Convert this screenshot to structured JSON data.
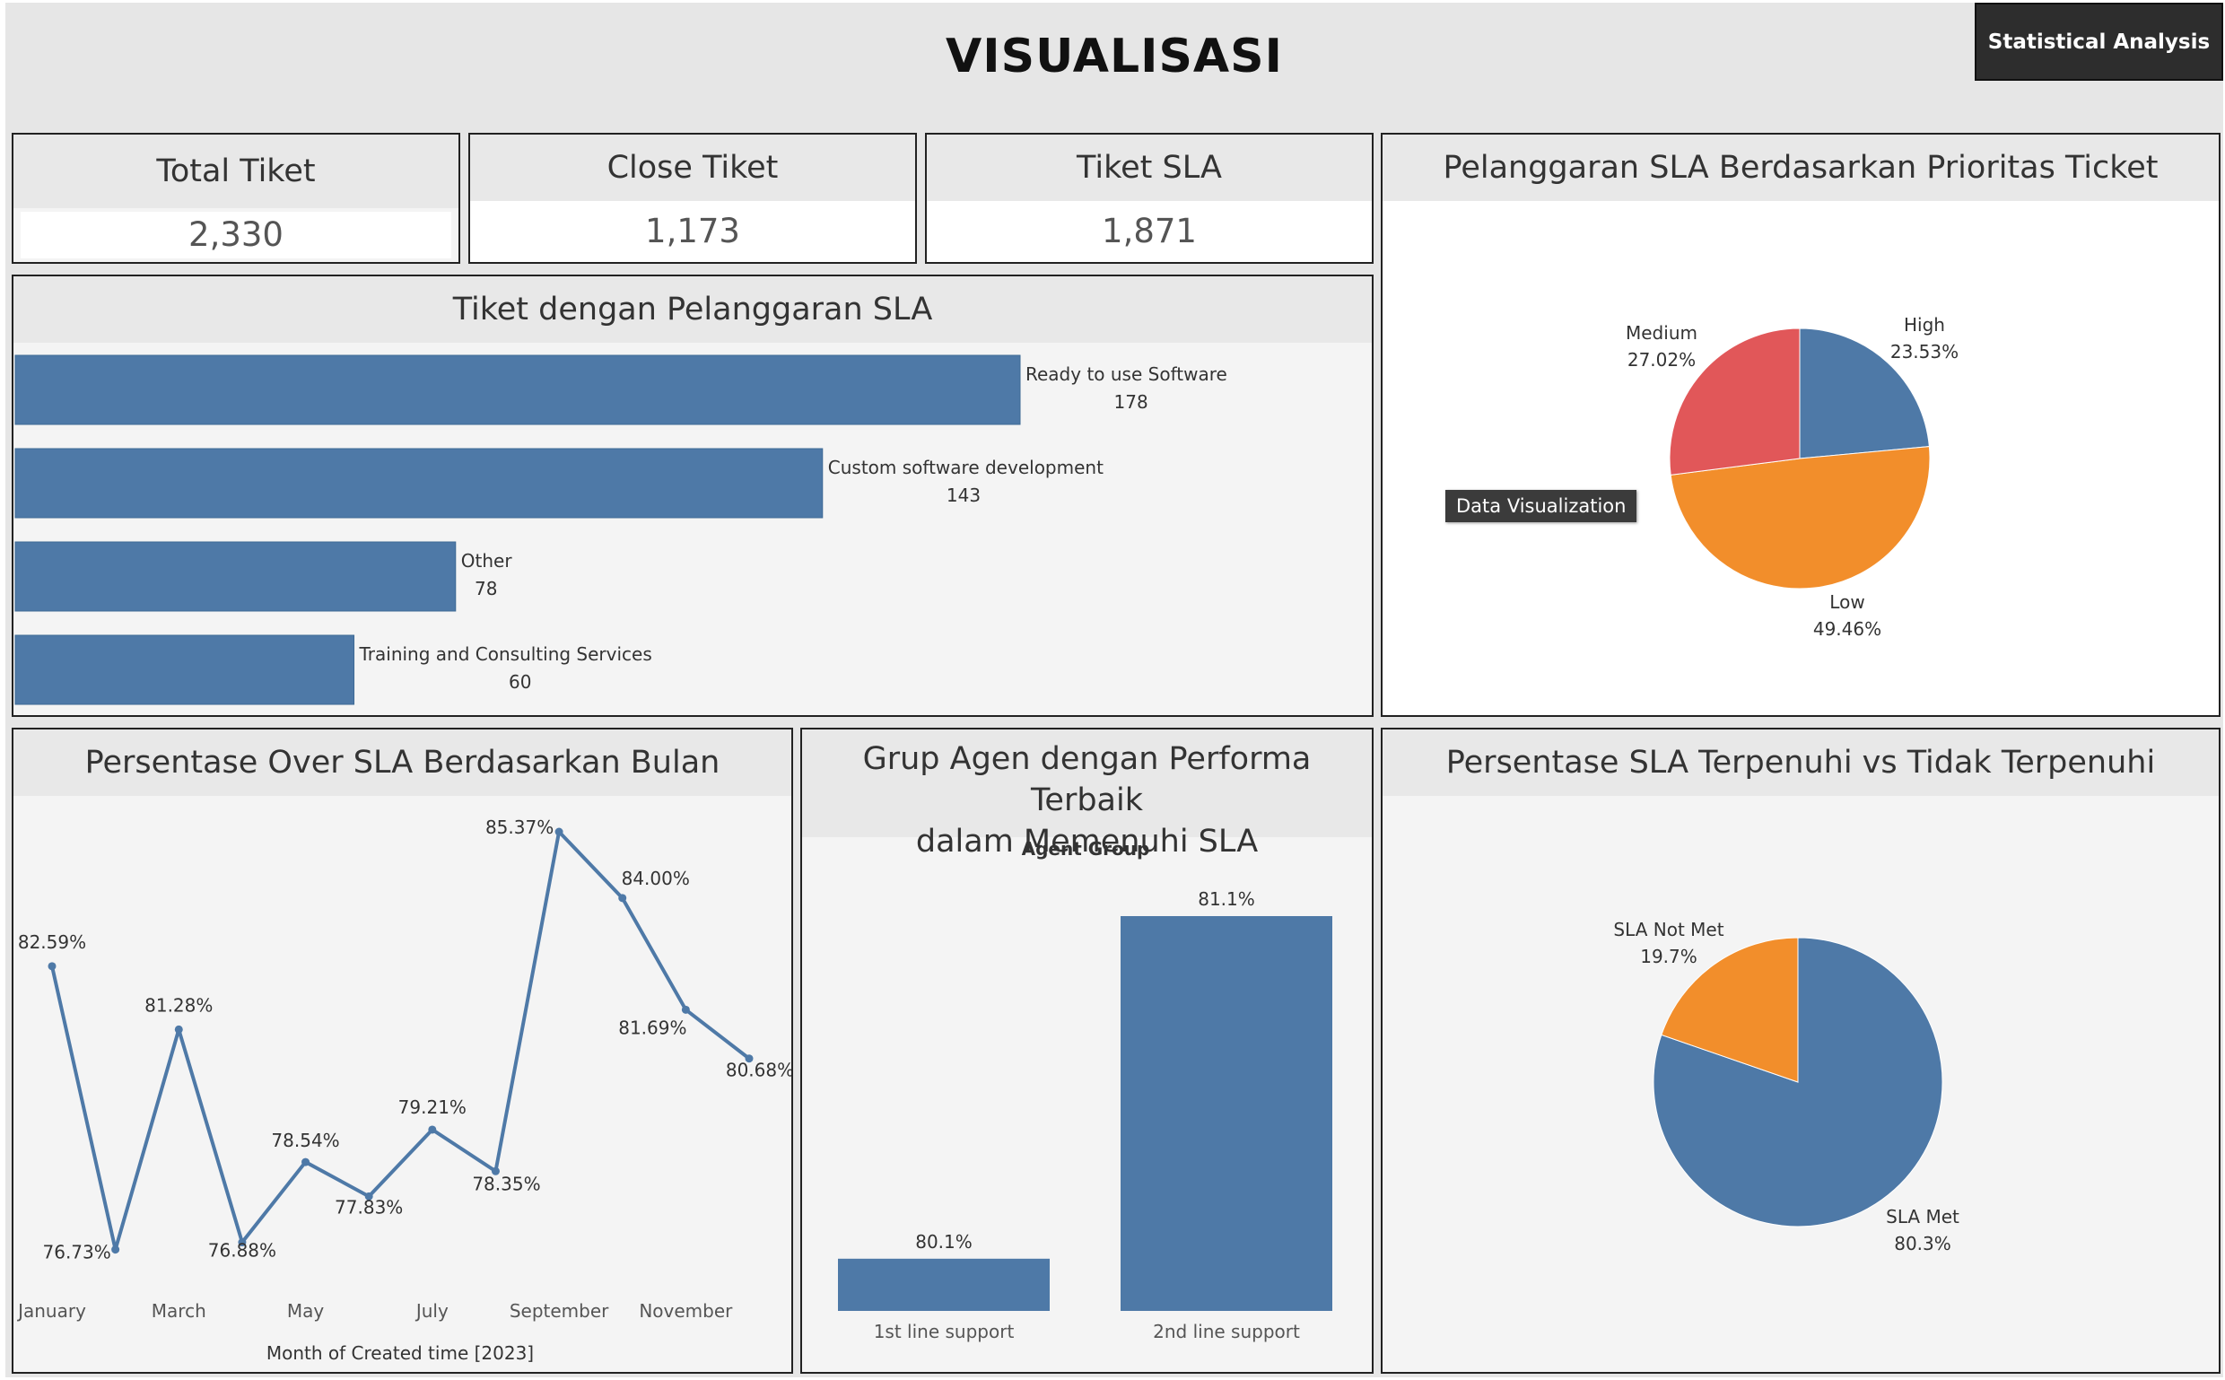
{
  "page": {
    "title": "VISUALISASI"
  },
  "toolbar": {
    "statistical_analysis_label": "Statistical Analysis"
  },
  "kpis": [
    {
      "label": "Total Tiket",
      "value": "2,330"
    },
    {
      "label": "Close Tiket",
      "value": "1,173"
    },
    {
      "label": "Tiket SLA",
      "value": "1,871"
    }
  ],
  "colors": {
    "blue": "#4e79a7",
    "orange": "#f28e2b",
    "red": "#e15759"
  },
  "panels": {
    "bar_violations": {
      "title": "Tiket dengan Pelanggaran SLA"
    },
    "priority_pie": {
      "title": "Pelanggaran SLA Berdasarkan Prioritas Ticket",
      "tooltip": "Data Visualization"
    },
    "monthly_line": {
      "title": "Persentase Over SLA Berdasarkan Bulan"
    },
    "agent_group": {
      "title_line1": "Grup Agen dengan Performa Terbaik",
      "title_line2": "dalam Memenuhi SLA"
    },
    "sla_pie": {
      "title": "Persentase SLA Terpenuhi vs Tidak Terpenuhi"
    }
  },
  "chart_data": [
    {
      "type": "bar",
      "orientation": "horizontal",
      "title": "Tiket dengan Pelanggaran SLA",
      "categories": [
        "Ready to use Software",
        "Custom software development",
        "Other",
        "Training and Consulting Services"
      ],
      "values": [
        178,
        143,
        78,
        60
      ],
      "value_labels": [
        "178",
        "143",
        "78",
        "60"
      ],
      "xlim": [
        0,
        178
      ],
      "grid": false
    },
    {
      "type": "pie",
      "title": "Pelanggaran SLA Berdasarkan Prioritas Ticket",
      "slices": [
        {
          "label": "High",
          "value": 23.53,
          "value_label": "23.53%",
          "color": "#4e79a7"
        },
        {
          "label": "Low",
          "value": 49.46,
          "value_label": "49.46%",
          "color": "#f28e2b"
        },
        {
          "label": "Medium",
          "value": 27.02,
          "value_label": "27.02%",
          "color": "#e15759"
        }
      ]
    },
    {
      "type": "line",
      "title": "Persentase Over SLA Berdasarkan Bulan",
      "xlabel": "Month of Created time [2023]",
      "x": [
        "January",
        "February",
        "March",
        "April",
        "May",
        "June",
        "July",
        "August",
        "September",
        "October",
        "November",
        "December"
      ],
      "x_tick_labels": [
        "January",
        "March",
        "May",
        "July",
        "September",
        "November"
      ],
      "values": [
        82.59,
        76.73,
        81.28,
        76.88,
        78.54,
        77.83,
        79.21,
        78.35,
        85.37,
        84.0,
        81.69,
        80.68
      ],
      "value_labels": [
        "82.59%",
        "76.73%",
        "81.28%",
        "76.88%",
        "78.54%",
        "77.83%",
        "79.21%",
        "78.35%",
        "85.37%",
        "84.00%",
        "81.69%",
        "80.68%"
      ],
      "ylim": [
        76.5,
        85.5
      ],
      "grid": false
    },
    {
      "type": "bar",
      "title": "Grup Agen dengan Performa Terbaik dalam Memenuhi SLA",
      "header_label": "Agent Group",
      "categories": [
        "1st line support",
        "2nd line support"
      ],
      "values": [
        80.1,
        81.1
      ],
      "value_labels": [
        "80.1%",
        "81.1%"
      ],
      "ylim": [
        80.0,
        81.1
      ],
      "grid": false
    },
    {
      "type": "pie",
      "title": "Persentase SLA Terpenuhi vs Tidak Terpenuhi",
      "slices": [
        {
          "label": "SLA Met",
          "value": 80.3,
          "value_label": "80.3%",
          "color": "#4e79a7"
        },
        {
          "label": "SLA Not Met",
          "value": 19.7,
          "value_label": "19.7%",
          "color": "#f28e2b"
        }
      ]
    }
  ]
}
